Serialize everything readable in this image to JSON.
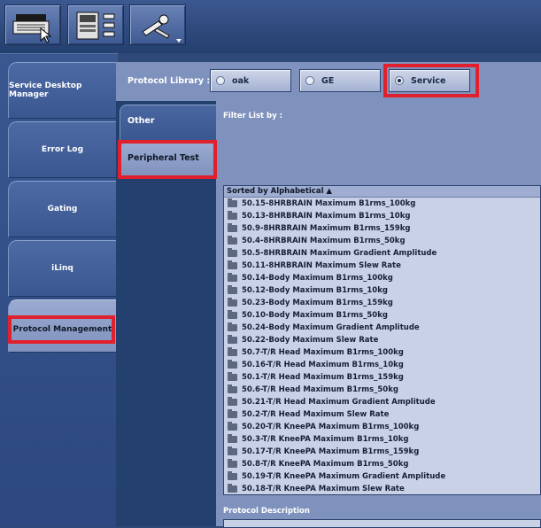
{
  "toolbar": {
    "buttons": [
      {
        "icon": "printer-icon"
      },
      {
        "icon": "scan-setup-icon"
      },
      {
        "icon": "wrench-tools-icon"
      }
    ]
  },
  "sidebar": {
    "items": [
      {
        "label": "Service Desktop Manager"
      },
      {
        "label": "Error Log"
      },
      {
        "label": "Gating"
      },
      {
        "label": "iLinq"
      },
      {
        "label": "Protocol Management"
      }
    ]
  },
  "protocol_library": {
    "label": "Protocol Library :",
    "options": [
      "oak",
      "GE",
      "Service"
    ],
    "selected": "Service"
  },
  "subtabs": [
    "Other",
    "Peripheral Test"
  ],
  "filter": {
    "label": "Filter List by :"
  },
  "list": {
    "header": "Sorted by Alphabetical ▲",
    "items": [
      "50.15-8HRBRAIN Maximum B1rms_100kg",
      "50.13-8HRBRAIN Maximum B1rms_10kg",
      "50.9-8HRBRAIN Maximum B1rms_159kg",
      "50.4-8HRBRAIN Maximum B1rms_50kg",
      "50.5-8HRBRAIN Maximum Gradient Amplitude",
      "50.11-8HRBRAIN Maximum Slew Rate",
      "50.14-Body Maximum B1rms_100kg",
      "50.12-Body Maximum B1rms_10kg",
      "50.23-Body Maximum B1rms_159kg",
      "50.10-Body Maximum B1rms_50kg",
      "50.24-Body Maximum Gradient Amplitude",
      "50.22-Body Maximum Slew Rate",
      "50.7-T/R Head Maximum B1rms_100kg",
      "50.16-T/R Head Maximum B1rms_10kg",
      "50.1-T/R Head Maximum B1rms_159kg",
      "50.6-T/R Head Maximum B1rms_50kg",
      "50.21-T/R Head Maximum Gradient Amplitude",
      "50.2-T/R Head Maximum Slew Rate",
      "50.20-T/R KneePA Maximum B1rms_100kg",
      "50.3-T/R KneePA Maximum B1rms_10kg",
      "50.17-T/R KneePA Maximum B1rms_159kg",
      "50.8-T/R KneePA Maximum B1rms_50kg",
      "50.19-T/R KneePA Maximum Gradient Amplitude",
      "50.18-T/R KneePA Maximum Slew Rate"
    ]
  },
  "description": {
    "label": "Protocol Description"
  },
  "colors": {
    "highlight": "#e0202c",
    "panel": "#7f92bd",
    "background": "#2e4878"
  }
}
